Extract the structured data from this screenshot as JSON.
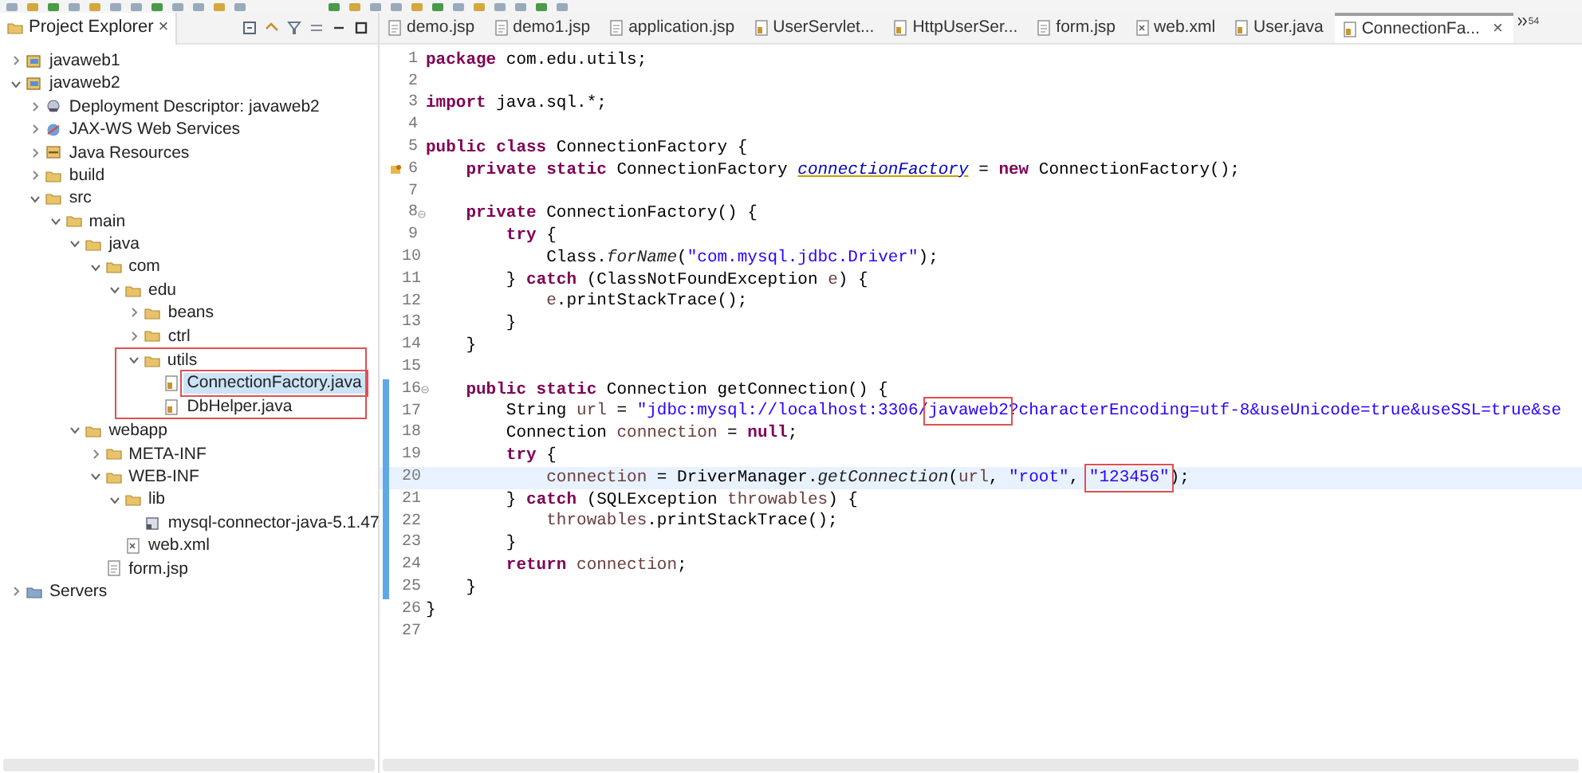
{
  "explorer": {
    "title": "Project Explorer",
    "close": "×",
    "tree": [
      {
        "label": "javaweb1",
        "kind": "project",
        "expanded": false,
        "selected": false
      },
      {
        "label": "javaweb2",
        "kind": "project",
        "expanded": true,
        "selected": false,
        "children": [
          {
            "label": "Deployment Descriptor: javaweb2",
            "kind": "deploy",
            "expanded": false,
            "selected": false
          },
          {
            "label": "JAX-WS Web Services",
            "kind": "webservice",
            "expanded": false,
            "selected": false
          },
          {
            "label": "Java Resources",
            "kind": "resources",
            "expanded": false,
            "selected": false
          },
          {
            "label": "build",
            "kind": "folder",
            "expanded": false,
            "selected": false
          },
          {
            "label": "src",
            "kind": "folder",
            "expanded": true,
            "selected": false,
            "children": [
              {
                "label": "main",
                "kind": "folder",
                "expanded": true,
                "selected": false,
                "children": [
                  {
                    "label": "java",
                    "kind": "folder",
                    "expanded": true,
                    "selected": false,
                    "children": [
                      {
                        "label": "com",
                        "kind": "folder",
                        "expanded": true,
                        "selected": false,
                        "children": [
                          {
                            "label": "edu",
                            "kind": "folder",
                            "expanded": true,
                            "selected": false,
                            "children": [
                              {
                                "label": "beans",
                                "kind": "folder",
                                "expanded": false,
                                "selected": false
                              },
                              {
                                "label": "ctrl",
                                "kind": "folder",
                                "expanded": false,
                                "selected": false
                              },
                              {
                                "label": "utils",
                                "kind": "folder",
                                "expanded": true,
                                "selected": false,
                                "annotated": true,
                                "children": [
                                  {
                                    "label": "ConnectionFactory.java",
                                    "kind": "java",
                                    "selected": true,
                                    "annotated": true
                                  },
                                  {
                                    "label": "DbHelper.java",
                                    "kind": "java",
                                    "selected": false
                                  }
                                ]
                              }
                            ]
                          }
                        ]
                      }
                    ]
                  },
                  {
                    "label": "webapp",
                    "kind": "folder",
                    "expanded": true,
                    "selected": false,
                    "children": [
                      {
                        "label": "META-INF",
                        "kind": "folder",
                        "expanded": false,
                        "selected": false
                      },
                      {
                        "label": "WEB-INF",
                        "kind": "folder",
                        "expanded": true,
                        "selected": false,
                        "children": [
                          {
                            "label": "lib",
                            "kind": "folder",
                            "expanded": true,
                            "selected": false,
                            "children": [
                              {
                                "label": "mysql-connector-java-5.1.47",
                                "kind": "jar",
                                "selected": false
                              }
                            ]
                          },
                          {
                            "label": "web.xml",
                            "kind": "xml",
                            "selected": false
                          }
                        ]
                      },
                      {
                        "label": "form.jsp",
                        "kind": "jsp",
                        "selected": false
                      }
                    ]
                  }
                ]
              }
            ]
          }
        ]
      },
      {
        "label": "Servers",
        "kind": "servers",
        "expanded": false,
        "selected": false
      }
    ]
  },
  "editor": {
    "tabs": [
      {
        "label": "demo.jsp",
        "kind": "jsp",
        "selected": false
      },
      {
        "label": "demo1.jsp",
        "kind": "jsp",
        "selected": false
      },
      {
        "label": "application.jsp",
        "kind": "jsp",
        "selected": false
      },
      {
        "label": "UserServlet...",
        "kind": "java",
        "selected": false
      },
      {
        "label": "HttpUserSer...",
        "kind": "java",
        "selected": false
      },
      {
        "label": "form.jsp",
        "kind": "jsp",
        "selected": false
      },
      {
        "label": "web.xml",
        "kind": "xml",
        "selected": false
      },
      {
        "label": "User.java",
        "kind": "java",
        "selected": false
      },
      {
        "label": "ConnectionFa...",
        "kind": "java",
        "selected": true,
        "close": "×"
      }
    ],
    "overflow_count": "54",
    "lines": [
      {
        "num": "1",
        "kind": "plain",
        "current": false,
        "changed": false,
        "tokens": [
          {
            "kind": "kw",
            "text": "package"
          },
          {
            "kind": "plain",
            "text": " com.edu.utils;"
          }
        ]
      },
      {
        "num": "2",
        "kind": "plain",
        "current": false,
        "changed": false
      },
      {
        "num": "3",
        "kind": "plain",
        "current": false,
        "changed": false,
        "tokens": [
          {
            "kind": "kw",
            "text": "import"
          },
          {
            "kind": "plain",
            "text": " java.sql.*;"
          }
        ]
      },
      {
        "num": "4",
        "kind": "plain",
        "current": false,
        "changed": false
      },
      {
        "num": "5",
        "kind": "plain",
        "current": false,
        "changed": false,
        "tokens": [
          {
            "kind": "kw",
            "text": "public class"
          },
          {
            "kind": "plain",
            "text": " ConnectionFactory {"
          }
        ]
      },
      {
        "num": "6",
        "kind": "warning",
        "current": false,
        "changed": false,
        "tokens": [
          {
            "kind": "kw",
            "text": "    private static"
          },
          {
            "kind": "plain",
            "text": " ConnectionFactory "
          },
          {
            "kind": "field",
            "text": "connectionFactory"
          },
          {
            "kind": "plain",
            "text": " = "
          },
          {
            "kind": "kw",
            "text": "new"
          },
          {
            "kind": "plain",
            "text": " ConnectionFactory();"
          }
        ]
      },
      {
        "num": "7",
        "kind": "plain",
        "current": false,
        "changed": false
      },
      {
        "num": "8",
        "kind": "fold",
        "current": false,
        "changed": false,
        "tokens": [
          {
            "kind": "kw",
            "text": "    private"
          },
          {
            "kind": "plain",
            "text": " ConnectionFactory() {"
          }
        ]
      },
      {
        "num": "9",
        "kind": "plain",
        "current": false,
        "changed": false,
        "tokens": [
          {
            "kind": "kw",
            "text": "        try"
          },
          {
            "kind": "plain",
            "text": " {"
          }
        ]
      },
      {
        "num": "10",
        "kind": "plain",
        "current": false,
        "changed": false,
        "tokens": [
          {
            "kind": "plain",
            "text": "            Class."
          },
          {
            "kind": "method",
            "text": "forName"
          },
          {
            "kind": "plain",
            "text": "("
          },
          {
            "kind": "str",
            "text": "\"com.mysql.jdbc.Driver\""
          },
          {
            "kind": "plain",
            "text": ");"
          }
        ]
      },
      {
        "num": "11",
        "kind": "plain",
        "current": false,
        "changed": false,
        "tokens": [
          {
            "kind": "plain",
            "text": "        } "
          },
          {
            "kind": "kw",
            "text": "catch"
          },
          {
            "kind": "plain",
            "text": " (ClassNotFoundException "
          },
          {
            "kind": "var",
            "text": "e"
          },
          {
            "kind": "plain",
            "text": ") {"
          }
        ]
      },
      {
        "num": "12",
        "kind": "plain",
        "current": false,
        "changed": false,
        "tokens": [
          {
            "kind": "var",
            "text": "            e"
          },
          {
            "kind": "plain",
            "text": ".printStackTrace();"
          }
        ]
      },
      {
        "num": "13",
        "kind": "plain",
        "current": false,
        "changed": false,
        "tokens": [
          {
            "kind": "plain",
            "text": "        }"
          }
        ]
      },
      {
        "num": "14",
        "kind": "plain",
        "current": false,
        "changed": false,
        "tokens": [
          {
            "kind": "plain",
            "text": "    }"
          }
        ]
      },
      {
        "num": "15",
        "kind": "plain",
        "current": false,
        "changed": false
      },
      {
        "num": "16",
        "kind": "fold",
        "current": false,
        "changed": true,
        "tokens": [
          {
            "kind": "kw",
            "text": "    public static"
          },
          {
            "kind": "plain",
            "text": " Connection getConnection() {"
          }
        ]
      },
      {
        "num": "17",
        "kind": "plain",
        "current": false,
        "changed": true,
        "tokens": [
          {
            "kind": "plain",
            "text": "        String "
          },
          {
            "kind": "var",
            "text": "url"
          },
          {
            "kind": "plain",
            "text": " = "
          },
          {
            "kind": "str",
            "text": "\"jdbc:mysql://localhost:3306/"
          },
          {
            "kind": "str",
            "text": "javaweb2",
            "boxed": true
          },
          {
            "kind": "str",
            "text": "?characterEncoding=utf-8&useUnicode=true&useSSL=true&se"
          }
        ]
      },
      {
        "num": "18",
        "kind": "plain",
        "current": false,
        "changed": true,
        "tokens": [
          {
            "kind": "plain",
            "text": "        Connection "
          },
          {
            "kind": "var",
            "text": "connection"
          },
          {
            "kind": "plain",
            "text": " = "
          },
          {
            "kind": "kw",
            "text": "null"
          },
          {
            "kind": "plain",
            "text": ";"
          }
        ]
      },
      {
        "num": "19",
        "kind": "plain",
        "current": false,
        "changed": true,
        "tokens": [
          {
            "kind": "kw",
            "text": "        try"
          },
          {
            "kind": "plain",
            "text": " {"
          }
        ]
      },
      {
        "num": "20",
        "kind": "plain",
        "current": true,
        "changed": true,
        "tokens": [
          {
            "kind": "var",
            "text": "            connection"
          },
          {
            "kind": "plain",
            "text": " = DriverManager."
          },
          {
            "kind": "method",
            "text": "getConnection"
          },
          {
            "kind": "plain",
            "text": "("
          },
          {
            "kind": "var",
            "text": "url"
          },
          {
            "kind": "plain",
            "text": ", "
          },
          {
            "kind": "str",
            "text": "\"root\""
          },
          {
            "kind": "plain",
            "text": ", "
          },
          {
            "kind": "str",
            "text": "\"123456\"",
            "boxed": true
          },
          {
            "kind": "plain",
            "text": ");"
          }
        ]
      },
      {
        "num": "21",
        "kind": "plain",
        "current": false,
        "changed": true,
        "tokens": [
          {
            "kind": "plain",
            "text": "        } "
          },
          {
            "kind": "kw",
            "text": "catch"
          },
          {
            "kind": "plain",
            "text": " (SQLException "
          },
          {
            "kind": "var",
            "text": "throwables"
          },
          {
            "kind": "plain",
            "text": ") {"
          }
        ]
      },
      {
        "num": "22",
        "kind": "plain",
        "current": false,
        "changed": true,
        "tokens": [
          {
            "kind": "var",
            "text": "            throwables"
          },
          {
            "kind": "plain",
            "text": ".printStackTrace();"
          }
        ]
      },
      {
        "num": "23",
        "kind": "plain",
        "current": false,
        "changed": true,
        "tokens": [
          {
            "kind": "plain",
            "text": "        }"
          }
        ]
      },
      {
        "num": "24",
        "kind": "plain",
        "current": false,
        "changed": true,
        "tokens": [
          {
            "kind": "kw",
            "text": "        return"
          },
          {
            "kind": "var",
            "text": " connection"
          },
          {
            "kind": "plain",
            "text": ";"
          }
        ]
      },
      {
        "num": "25",
        "kind": "plain",
        "current": false,
        "changed": true,
        "tokens": [
          {
            "kind": "plain",
            "text": "    }"
          }
        ]
      },
      {
        "num": "26",
        "kind": "plain",
        "current": false,
        "changed": false,
        "tokens": [
          {
            "kind": "plain",
            "text": "}"
          }
        ]
      },
      {
        "num": "27",
        "kind": "plain",
        "current": false,
        "changed": false
      }
    ]
  }
}
